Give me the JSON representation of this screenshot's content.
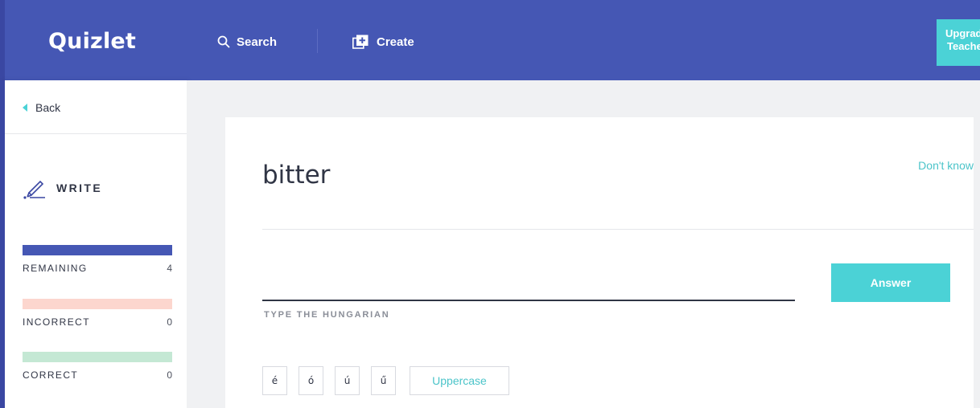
{
  "topbar": {
    "logo": "Quizlet",
    "search_label": "Search",
    "create_label": "Create",
    "upgrade_line1": "Upgrade",
    "upgrade_line2": "Teacher"
  },
  "sidebar": {
    "back_label": "Back",
    "mode_label": "WRITE",
    "stats": [
      {
        "label": "REMAINING",
        "count": "4",
        "color": "#4557b4"
      },
      {
        "label": "INCORRECT",
        "count": "0",
        "color": "#fcd6ce"
      },
      {
        "label": "CORRECT",
        "count": "0",
        "color": "#c4e8d4"
      }
    ]
  },
  "main": {
    "prompt": "bitter",
    "dont_know": "Don't know",
    "answer_value": "",
    "answer_label": "Answer",
    "type_hint": "TYPE THE HUNGARIAN",
    "special_chars": [
      "é",
      "ó",
      "ú",
      "ű"
    ],
    "uppercase_label": "Uppercase"
  },
  "colors": {
    "brand": "#4557b4",
    "accent": "#4bd2d6"
  }
}
